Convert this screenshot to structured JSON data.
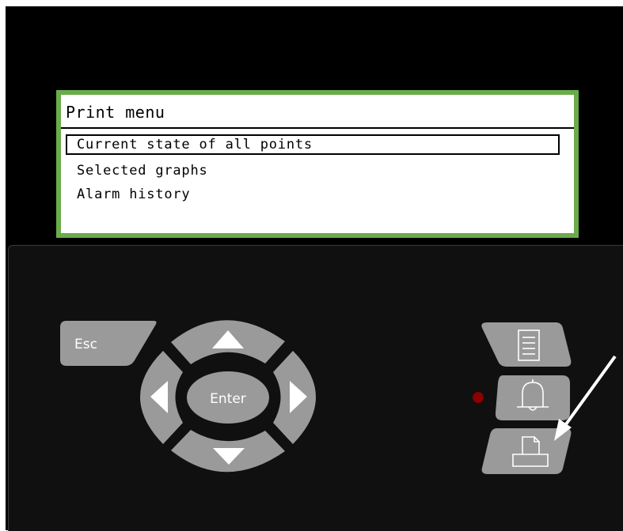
{
  "lcd": {
    "title": "Print menu",
    "items": [
      {
        "label": "Current state of all points",
        "selected": true
      },
      {
        "label": "Selected graphs",
        "selected": false
      },
      {
        "label": "Alarm history",
        "selected": false
      }
    ]
  },
  "keypad": {
    "esc_label": "Esc",
    "enter_label": "Enter"
  },
  "icons": {
    "report": "report-document-icon",
    "alarm": "bell-icon",
    "print": "printer-icon",
    "pointer": "arrow-pointer-icon"
  },
  "colors": {
    "lcd_border": "#6aac4a",
    "key_gray": "#9a9a9a",
    "status_led": "#8b0000",
    "background": "#000000"
  }
}
